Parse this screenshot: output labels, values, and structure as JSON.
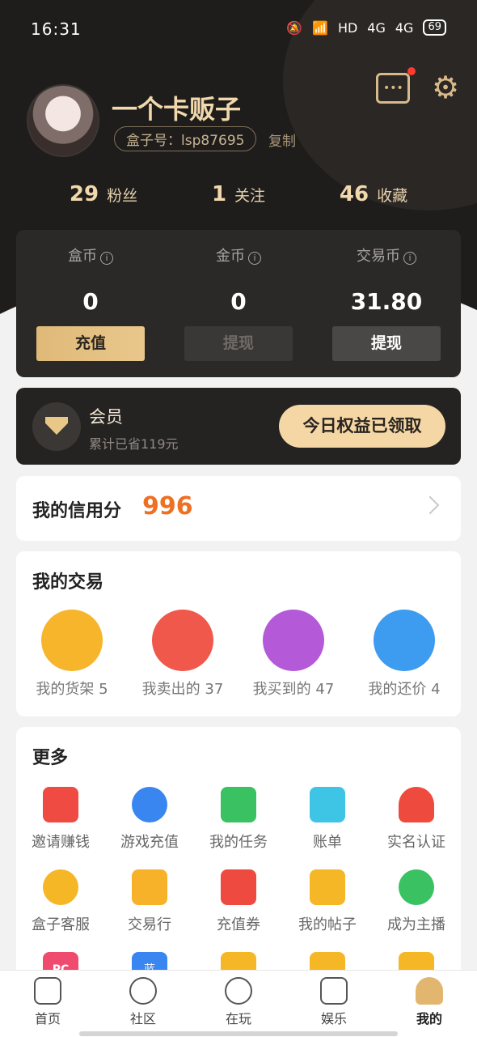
{
  "status": {
    "time": "16:31",
    "network": "HD",
    "signal1": "4G",
    "signal2": "4G",
    "battery": "69"
  },
  "profile": {
    "name": "一个卡贩子",
    "box_id": "盒子号：lsp87695",
    "copy_label": "复制"
  },
  "stats": [
    {
      "value": "29",
      "label": "粉丝"
    },
    {
      "value": "1",
      "label": "关注"
    },
    {
      "value": "46",
      "label": "收藏"
    }
  ],
  "wallet": [
    {
      "label": "盒币",
      "value": "0",
      "button": "充值"
    },
    {
      "label": "金币",
      "value": "0",
      "button": "提现"
    },
    {
      "label": "交易币",
      "value": "31.80",
      "button": "提现"
    }
  ],
  "vip": {
    "title": "会员",
    "subtitle": "累计已省119元",
    "button": "今日权益已领取"
  },
  "credit": {
    "label": "我的信用分",
    "score": "996"
  },
  "trade": {
    "title": "我的交易",
    "items": [
      {
        "label": "我的货架 5",
        "color": "#f7b52c",
        "icon": "layers-icon"
      },
      {
        "label": "我卖出的 37",
        "color": "#f0584b",
        "icon": "sell-icon"
      },
      {
        "label": "我买到的 47",
        "color": "#b45ad9",
        "icon": "bought-icon"
      },
      {
        "label": "我的还价 4",
        "color": "#3d9bf0",
        "icon": "tag-icon"
      }
    ]
  },
  "more": {
    "title": "更多",
    "items": [
      {
        "label": "邀请赚钱",
        "color": "#ef4b43",
        "icon": "red-envelope-icon"
      },
      {
        "label": "游戏充值",
        "color": "#3a86f0",
        "icon": "gamepad-icon"
      },
      {
        "label": "我的任务",
        "color": "#39c162",
        "icon": "task-icon"
      },
      {
        "label": "账单",
        "color": "#3ec4e5",
        "icon": "bill-icon"
      },
      {
        "label": "实名认证",
        "color": "#ee4a3d",
        "icon": "verify-icon"
      },
      {
        "label": "盒子客服",
        "color": "#f5b726",
        "icon": "support-icon"
      },
      {
        "label": "交易行",
        "color": "#f7b22a",
        "icon": "shop-icon"
      },
      {
        "label": "充值券",
        "color": "#ef4a40",
        "icon": "coupon-icon"
      },
      {
        "label": "我的帖子",
        "color": "#f5b726",
        "icon": "post-icon"
      },
      {
        "label": "成为主播",
        "color": "#39c162",
        "icon": "mic-icon"
      }
    ],
    "partial_icons": [
      {
        "text": "PC",
        "color": "#ef4b6f"
      },
      {
        "text": "蓝",
        "color": "#3a86f0"
      },
      {
        "text": "",
        "color": "#f5b726"
      },
      {
        "text": "",
        "color": "#f5b726"
      },
      {
        "text": "",
        "color": "#f5b726"
      }
    ]
  },
  "tabs": [
    {
      "label": "首页",
      "icon": "home-icon"
    },
    {
      "label": "社区",
      "icon": "compass-icon"
    },
    {
      "label": "在玩",
      "icon": "play-icon"
    },
    {
      "label": "娱乐",
      "icon": "tv-icon"
    },
    {
      "label": "我的",
      "icon": "profile-icon",
      "active": true
    }
  ]
}
